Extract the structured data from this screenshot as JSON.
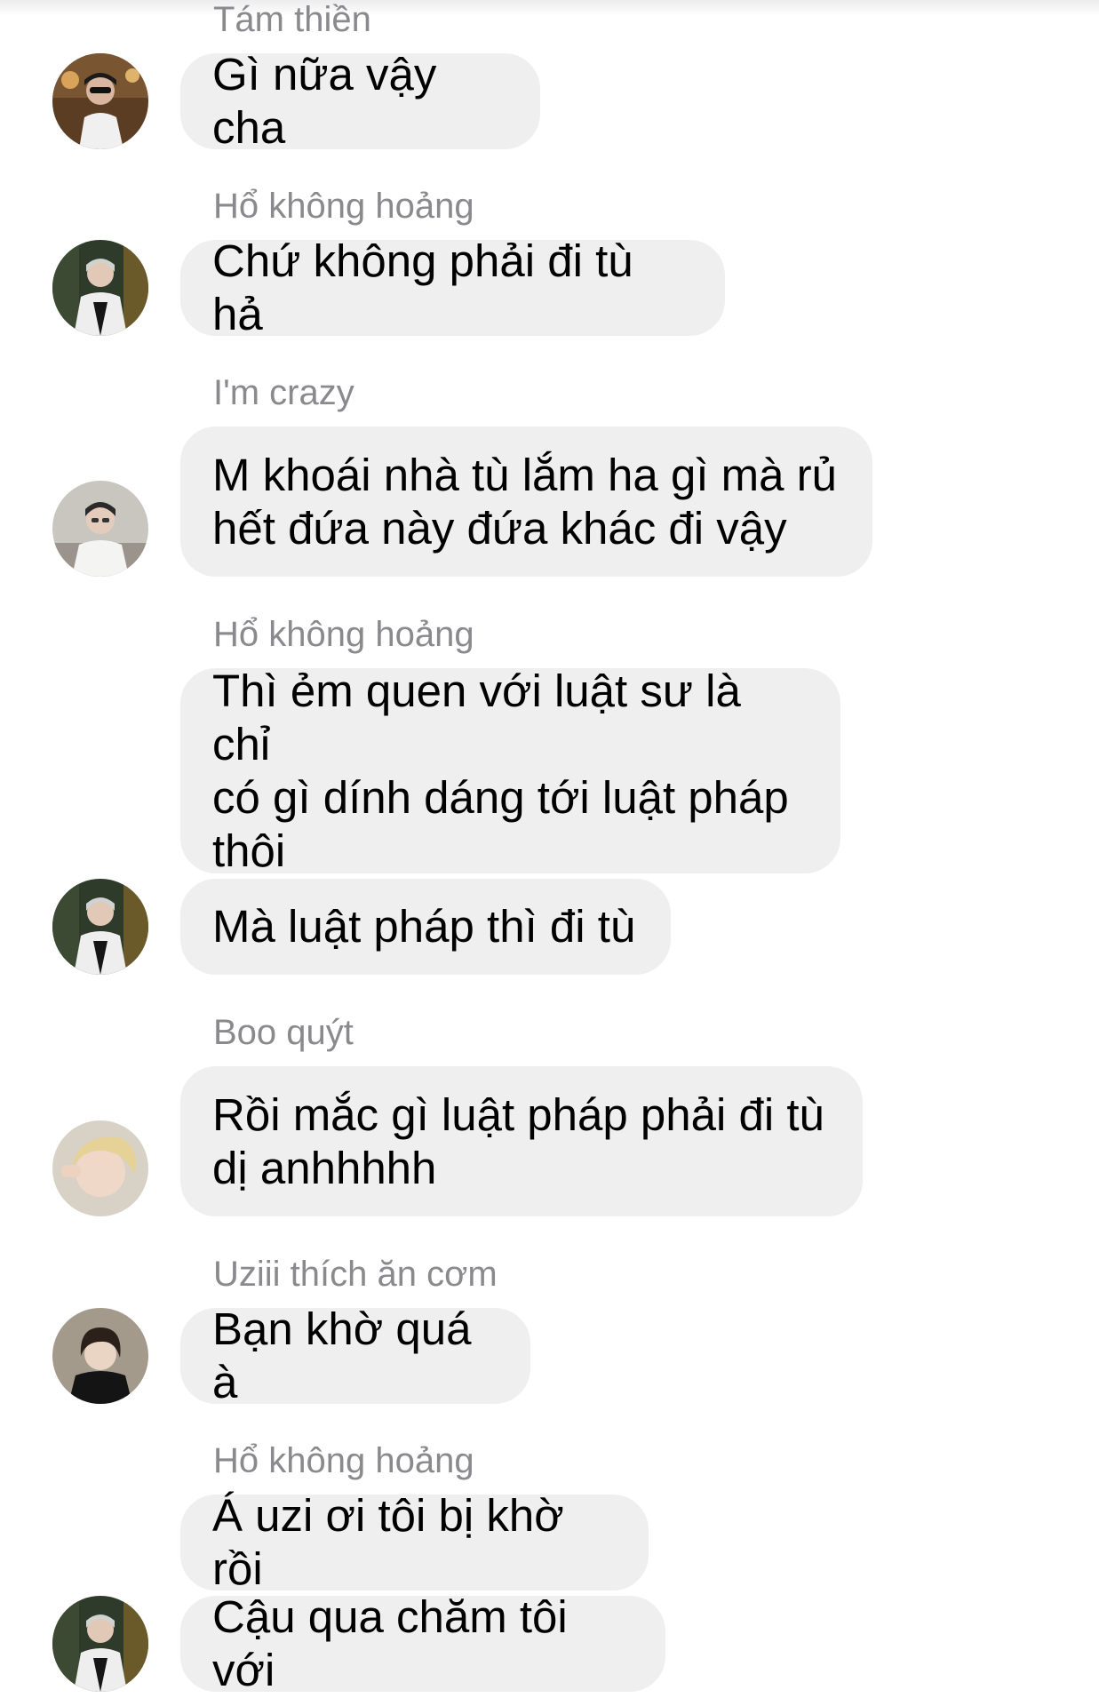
{
  "conversation": {
    "groups": [
      {
        "sender": "Tám thiền",
        "messages": [
          "Gì nữa vậy cha"
        ]
      },
      {
        "sender": "Hổ không hoảng",
        "messages": [
          "Chứ không phải đi tù hả"
        ]
      },
      {
        "sender": "I'm crazy",
        "messages": [
          "M khoái nhà tù lắm ha gì mà rủ\nhết đứa này đứa khác đi vậy"
        ]
      },
      {
        "sender": "Hổ không hoảng",
        "messages": [
          "Thì ẻm quen với luật sư là chỉ\ncó gì dính dáng tới luật pháp\nthôi",
          "Mà luật pháp thì đi tù"
        ]
      },
      {
        "sender": "Boo quýt",
        "messages": [
          "Rồi mắc gì luật pháp phải đi tù\ndị anhhhhh"
        ]
      },
      {
        "sender": "Uziii thích ăn cơm",
        "messages": [
          "Bạn khờ quá à"
        ]
      },
      {
        "sender": "Hổ không hoảng",
        "messages": [
          "Á uzi ơi tôi bị khờ rồi",
          "Cậu qua chăm tôi với"
        ]
      }
    ]
  },
  "colors": {
    "bubble_background": "#efeff0",
    "sender_text": "#8a8a8e",
    "message_text": "#000000"
  }
}
